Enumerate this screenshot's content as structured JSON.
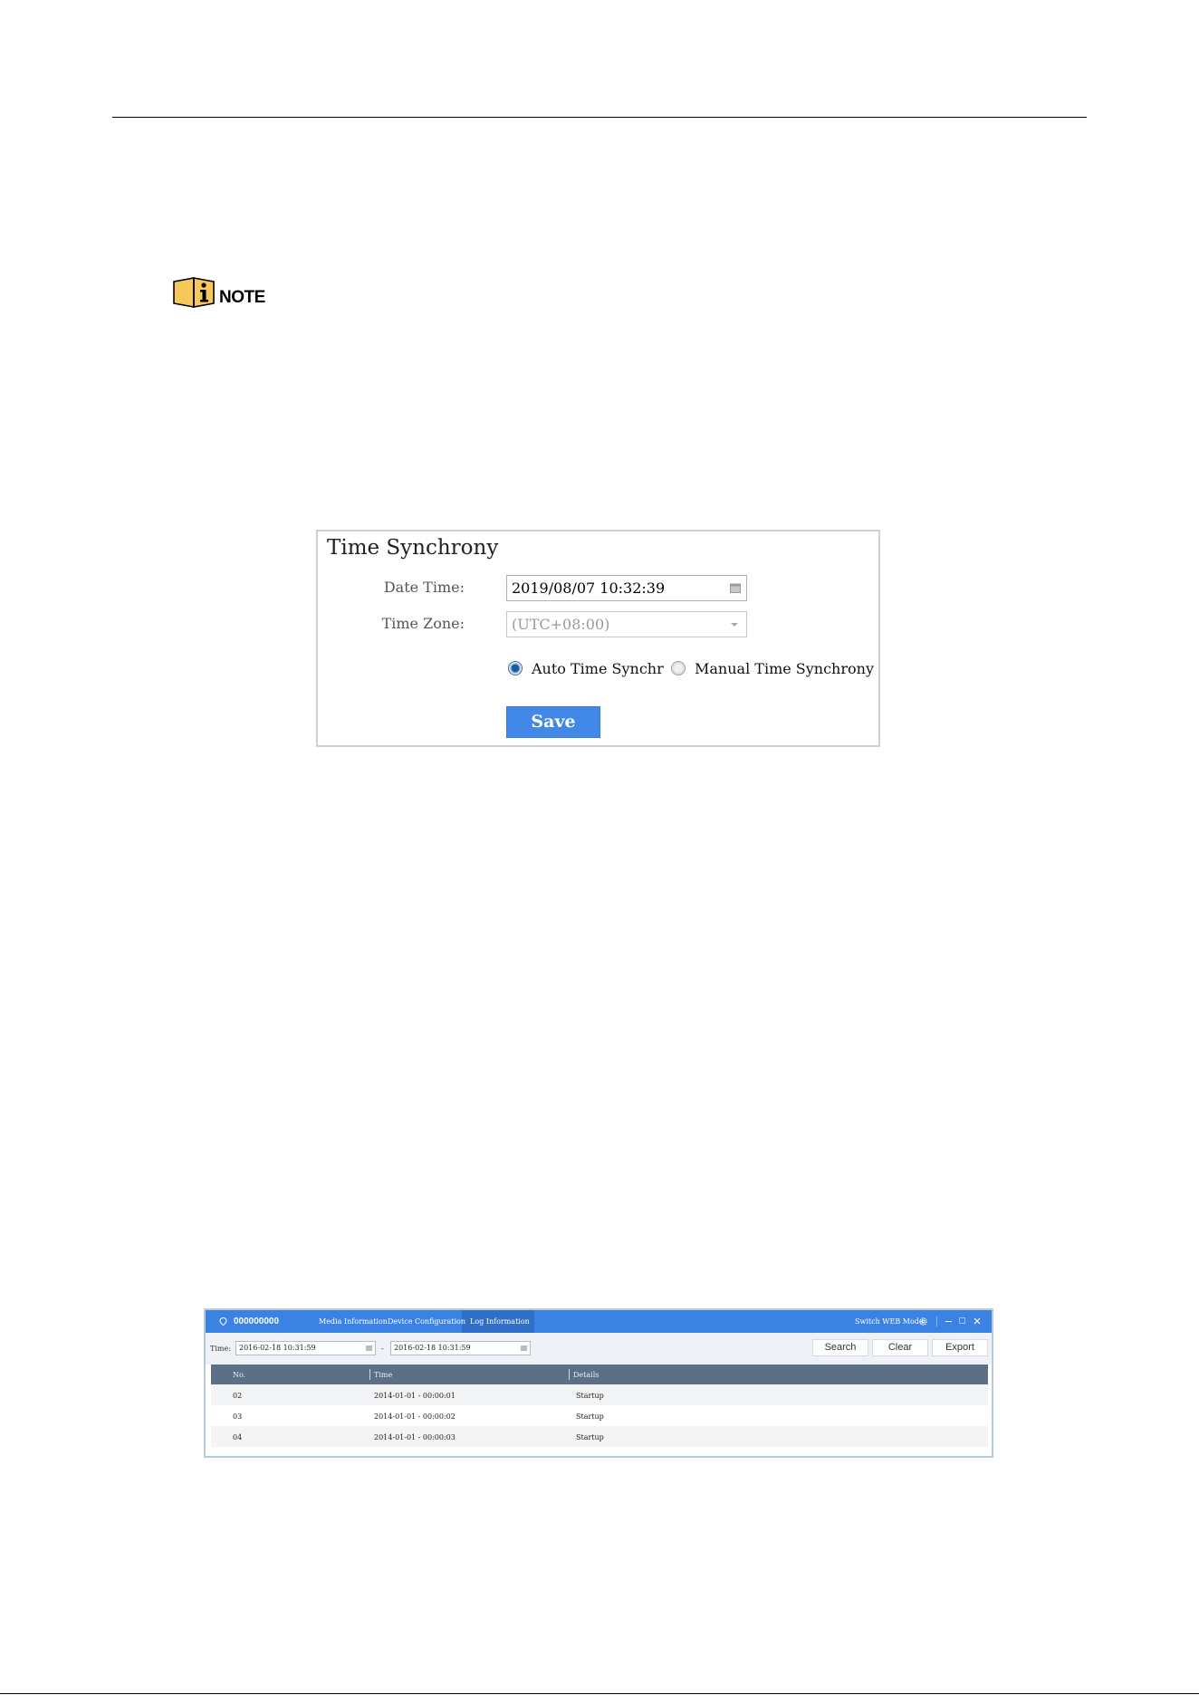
{
  "note": {
    "label": "NOTE"
  },
  "time_synchrony": {
    "title": "Time Synchrony",
    "date_time_label": "Date Time:",
    "date_time_value": "2019/08/07 10:32:39",
    "time_zone_label": "Time Zone:",
    "time_zone_value": "(UTC+08:00)",
    "auto_label": "Auto Time Synchr",
    "manual_label": "Manual Time Synchrony",
    "selected_mode": "auto",
    "save_label": "Save"
  },
  "log_window": {
    "device_name": "000000000",
    "tabs": [
      "Media Information",
      "Device Configuration",
      "Log Information"
    ],
    "active_tab": "Log Information",
    "switch_mode_label": "Switch WEB Mode",
    "time_label": "Time:",
    "start_time": "2016-02-18 10:31:59",
    "range_separator": "-",
    "end_time": "2016-02-18 10:31:59",
    "search_label": "Search",
    "clear_label": "Clear",
    "export_label": "Export",
    "columns": [
      "No.",
      "Time",
      "Details"
    ],
    "rows": [
      {
        "no": "02",
        "time": "2014-01-01 - 00:00:01",
        "details": "Startup"
      },
      {
        "no": "03",
        "time": "2014-01-01 - 00:00:02",
        "details": "Startup"
      },
      {
        "no": "04",
        "time": "2014-01-01 - 00:00:03",
        "details": "Startup"
      }
    ],
    "colors": {
      "titlebar": "#3b83e3",
      "grid_header": "#5b6f87"
    }
  }
}
